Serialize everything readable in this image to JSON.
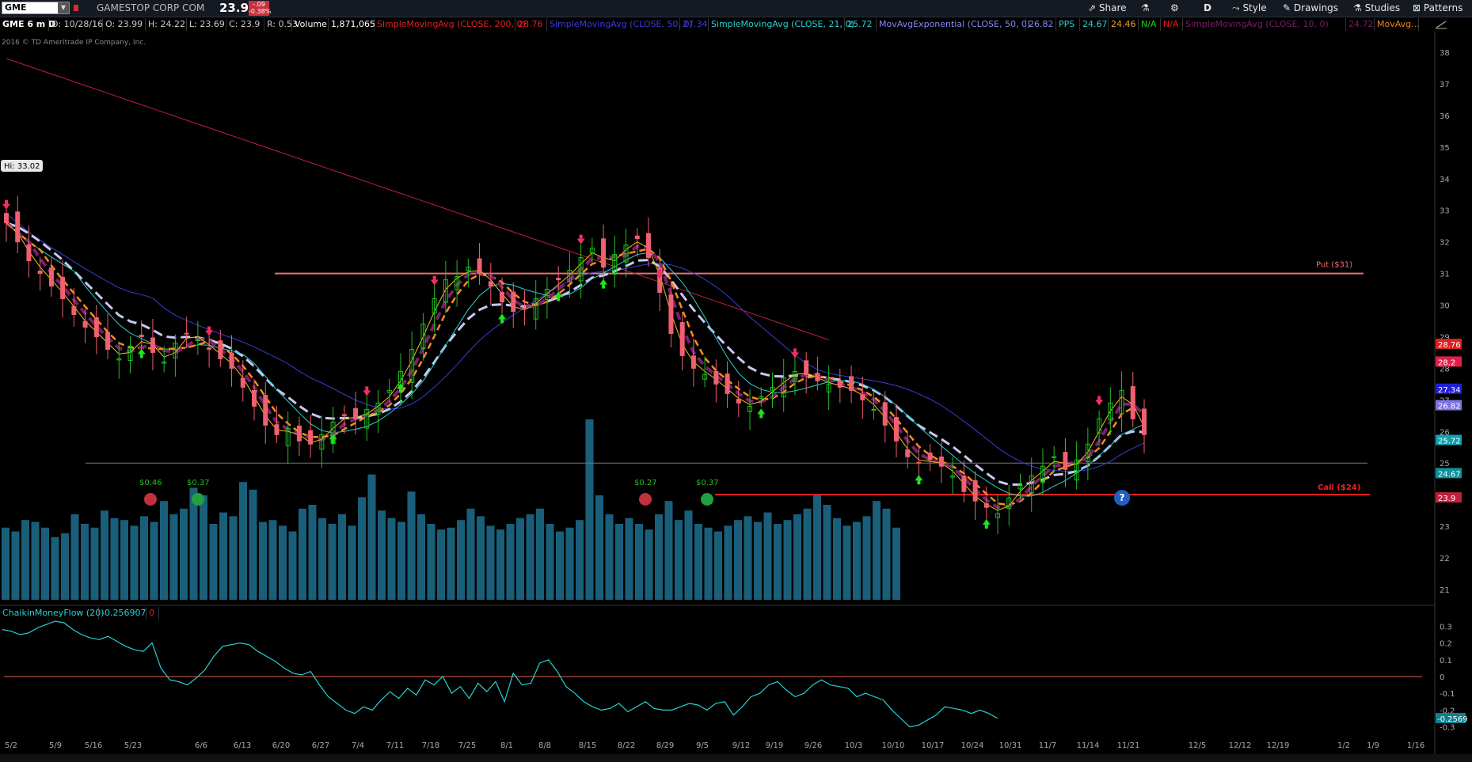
{
  "symbol": "GME",
  "company": "GAMESTOP CORP COM",
  "last_price": "23.90",
  "change": "-.09",
  "change_pct": "-0.38%",
  "chart_label": "GME 6 m D",
  "ohlc": {
    "date": "D: 10/28/16",
    "open": "O: 23.99",
    "high": "H: 24.22",
    "low": "L: 23.69",
    "close": "C: 23.9",
    "range": "R: 0.53"
  },
  "volume_label": "Volume",
  "volume_value": "1,871,065",
  "studies": [
    {
      "label": "SimpleMovingAvg (CLOSE, 200, 0)",
      "value": "28.76",
      "color": "#e02020"
    },
    {
      "label": "SimpleMovingAvg (CLOSE, 50, 0)",
      "value": "27.34",
      "color": "#3b3bd8"
    },
    {
      "label": "SimpleMovingAvg (CLOSE, 21, 0)",
      "value": "25.72",
      "color": "#2ad1d1"
    },
    {
      "label": "MovAvgExponential (CLOSE, 50, 0)",
      "value": "26.82",
      "color": "#8c84f0"
    }
  ],
  "pps": {
    "label": "PPS",
    "v1": "24.67",
    "v2": "24.46",
    "v3": "N/A",
    "v4": "N/A"
  },
  "study_extra": {
    "label": "SimpleMovingAvg (CLOSE, 10, 0)",
    "value": "24.72",
    "more": "MovAvg..."
  },
  "copyright": "2016 © TD Ameritrade IP Company, Inc.",
  "toolbar": {
    "share": "Share",
    "period": "D",
    "style": "Style",
    "drawings": "Drawings",
    "studies": "Studies",
    "patterns": "Patterns"
  },
  "hi_label": "Hi: 33.02",
  "levels": {
    "put": "Put ($31)",
    "call": "Call ($24)"
  },
  "price_tags": [
    {
      "text": "28.76",
      "bg": "#e02020",
      "y": 28.76
    },
    {
      "text": "28.2",
      "bg": "#e0204a",
      "y": 28.2
    },
    {
      "text": "27.34",
      "bg": "#2020d0",
      "y": 27.34
    },
    {
      "text": "26.82",
      "bg": "#7c74e0",
      "y": 26.82
    },
    {
      "text": "25.72",
      "bg": "#10a0b0",
      "y": 25.72
    },
    {
      "text": "24.67",
      "bg": "#10909a",
      "y": 24.67
    },
    {
      "text": "23.9",
      "bg": "#c0203a",
      "y": 23.9
    }
  ],
  "cmf": {
    "label": "ChaikinMoneyFlow (20)",
    "value": "-0.256907",
    "zero": "0",
    "tag": "-0.2569"
  },
  "events": [
    "$0.46",
    "$0.37",
    "$0.27",
    "$0.37"
  ],
  "help": "?",
  "chart_data": {
    "type": "candlestick",
    "y_axis_ticks": [
      "38",
      "37",
      "36",
      "35",
      "34",
      "33",
      "32",
      "31",
      "30",
      "29",
      "28",
      "27",
      "26",
      "25",
      "24",
      "23",
      "22",
      "21"
    ],
    "ylim": [
      20.6,
      38.6
    ],
    "cmf_ticks": [
      "0.3",
      "0.2",
      "0.1",
      "0",
      "-0.1",
      "-0.2",
      "-0.3"
    ],
    "cmf_ylim": [
      -0.33,
      0.33
    ],
    "x_dates": [
      "5/2",
      "5/9",
      "5/16",
      "5/23",
      "6/6",
      "6/13",
      "6/20",
      "6/27",
      "7/4",
      "7/11",
      "7/18",
      "7/25",
      "8/1",
      "8/8",
      "8/15",
      "8/22",
      "8/29",
      "9/5",
      "9/12",
      "9/19",
      "9/26",
      "10/3",
      "10/10",
      "10/17",
      "10/24",
      "10/31",
      "11/7",
      "11/14",
      "11/21",
      "12/5",
      "12/12",
      "12/19",
      "1/2",
      "1/9",
      "1/16"
    ],
    "levels": {
      "put": 31,
      "call": 24,
      "support": 25
    },
    "closes": [
      32.6,
      32.0,
      31.4,
      31.0,
      30.6,
      30.2,
      29.7,
      29.3,
      29.0,
      28.6,
      28.3,
      28.7,
      29.0,
      28.5,
      28.2,
      28.8,
      29.1,
      28.9,
      28.6,
      28.3,
      28.0,
      27.4,
      26.8,
      26.2,
      25.9,
      26.1,
      25.7,
      25.6,
      25.9,
      26.3,
      26.5,
      26.4,
      26.7,
      26.9,
      27.3,
      27.9,
      28.6,
      29.4,
      30.2,
      30.8,
      30.9,
      31.2,
      31.0,
      30.6,
      30.1,
      29.8,
      29.9,
      30.2,
      30.5,
      30.8,
      31.1,
      31.5,
      31.8,
      31.2,
      31.6,
      31.9,
      32.1,
      31.5,
      30.4,
      29.1,
      28.4,
      28.0,
      27.8,
      27.5,
      27.2,
      26.9,
      26.8,
      27.1,
      27.4,
      27.7,
      27.9,
      27.8,
      27.6,
      27.5,
      27.4,
      27.3,
      27.0,
      26.7,
      26.2,
      25.7,
      25.2,
      25.0,
      25.1,
      24.9,
      24.6,
      24.1,
      23.8,
      23.6,
      23.4,
      23.9,
      24.3,
      24.6,
      24.9,
      25.2,
      24.8,
      25.1,
      25.6,
      26.4,
      26.9,
      27.3,
      26.4,
      25.9
    ],
    "volume": [
      0.38,
      0.36,
      0.42,
      0.41,
      0.38,
      0.33,
      0.35,
      0.45,
      0.4,
      0.38,
      0.47,
      0.43,
      0.42,
      0.39,
      0.44,
      0.41,
      0.52,
      0.45,
      0.48,
      0.59,
      0.55,
      0.4,
      0.46,
      0.44,
      0.62,
      0.58,
      0.41,
      0.42,
      0.39,
      0.36,
      0.48,
      0.5,
      0.43,
      0.4,
      0.45,
      0.39,
      0.54,
      0.66,
      0.47,
      0.43,
      0.41,
      0.57,
      0.45,
      0.4,
      0.37,
      0.38,
      0.42,
      0.48,
      0.44,
      0.39,
      0.37,
      0.4,
      0.43,
      0.45,
      0.48,
      0.4,
      0.36,
      0.38,
      0.42,
      0.95,
      0.55,
      0.45,
      0.4,
      0.43,
      0.4,
      0.37,
      0.45,
      0.52,
      0.42,
      0.47,
      0.4,
      0.38,
      0.36,
      0.39,
      0.42,
      0.44,
      0.41,
      0.46,
      0.4,
      0.42,
      0.45,
      0.48,
      0.55,
      0.5,
      0.43,
      0.39,
      0.41,
      0.44,
      0.52,
      0.48,
      0.38
    ],
    "cmf": [
      0.28,
      0.27,
      0.25,
      0.26,
      0.29,
      0.31,
      0.33,
      0.32,
      0.28,
      0.25,
      0.23,
      0.22,
      0.24,
      0.21,
      0.18,
      0.16,
      0.15,
      0.2,
      0.05,
      -0.02,
      -0.03,
      -0.05,
      -0.01,
      0.04,
      0.12,
      0.18,
      0.19,
      0.2,
      0.19,
      0.15,
      0.12,
      0.09,
      0.05,
      0.02,
      0.01,
      0.03,
      -0.05,
      -0.12,
      -0.16,
      -0.2,
      -0.22,
      -0.18,
      -0.2,
      -0.14,
      -0.09,
      -0.13,
      -0.07,
      -0.11,
      -0.02,
      -0.05,
      0.0,
      -0.1,
      -0.06,
      -0.13,
      -0.04,
      -0.09,
      -0.03,
      -0.15,
      0.02,
      -0.05,
      -0.04,
      0.08,
      0.1,
      0.03,
      -0.06,
      -0.1,
      -0.15,
      -0.18,
      -0.2,
      -0.19,
      -0.16,
      -0.21,
      -0.18,
      -0.15,
      -0.19,
      -0.2,
      -0.2,
      -0.18,
      -0.16,
      -0.17,
      -0.2,
      -0.16,
      -0.15,
      -0.23,
      -0.18,
      -0.12,
      -0.1,
      -0.05,
      -0.03,
      -0.08,
      -0.12,
      -0.1,
      -0.05,
      -0.02,
      -0.05,
      -0.06,
      -0.07,
      -0.12,
      -0.1,
      -0.12,
      -0.14,
      -0.2,
      -0.25,
      -0.3,
      -0.29,
      -0.26,
      -0.23,
      -0.18,
      -0.19,
      -0.2,
      -0.22,
      -0.2,
      -0.22,
      -0.25
    ]
  }
}
